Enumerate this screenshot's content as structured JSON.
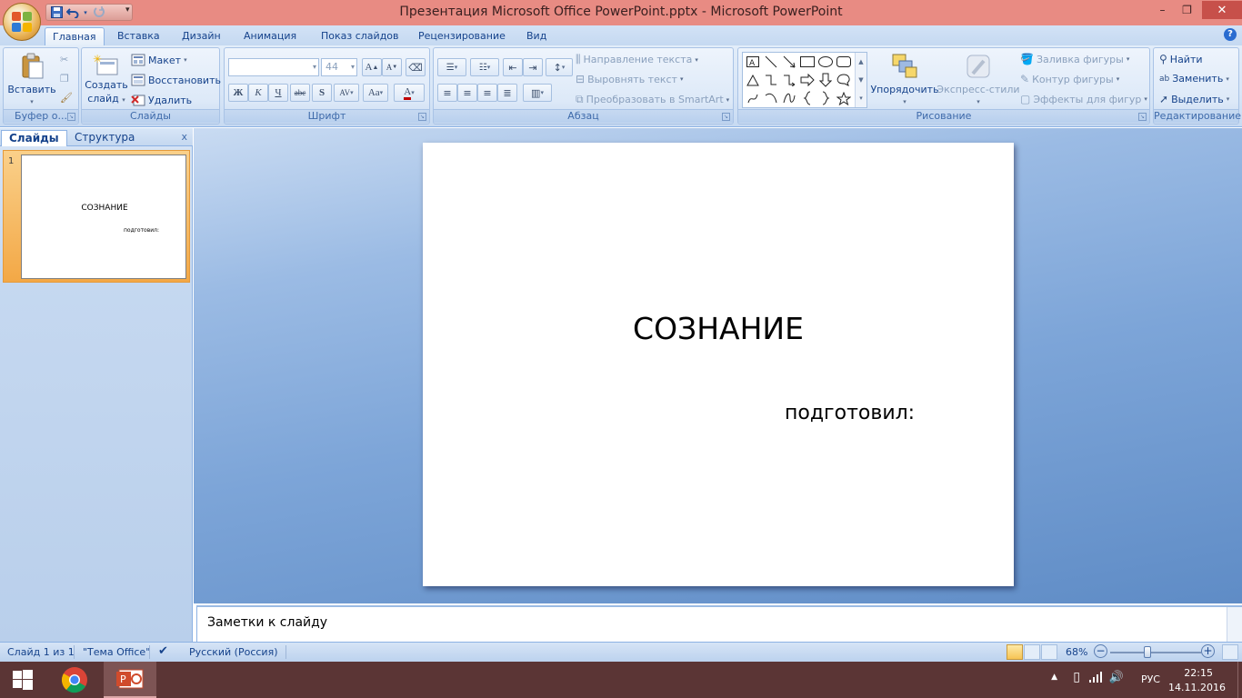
{
  "window": {
    "title": "Презентация Microsoft Office PowerPoint.pptx - Microsoft PowerPoint",
    "minimize": "–",
    "restore": "❐",
    "close": "✕"
  },
  "tabs": [
    "Главная",
    "Вставка",
    "Дизайн",
    "Анимация",
    "Показ слайдов",
    "Рецензирование",
    "Вид"
  ],
  "ribbon": {
    "clipboard": {
      "paste": "Вставить",
      "label": "Буфер о..."
    },
    "slides": {
      "new_slide_1": "Создать",
      "new_slide_2": "слайд",
      "layout": "Макет",
      "reset": "Восстановить",
      "delete": "Удалить",
      "label": "Слайды"
    },
    "font": {
      "font_name": "",
      "font_size": "44",
      "bold": "Ж",
      "italic": "К",
      "underline": "Ч",
      "strike": "abc",
      "shadow": "S",
      "spacing": "AV",
      "case": "Aa",
      "grow": "A",
      "shrink": "A",
      "label": "Шрифт"
    },
    "paragraph": {
      "text_direction": "Направление текста",
      "align_text": "Выровнять текст",
      "smartart": "Преобразовать в SmartArt",
      "label": "Абзац"
    },
    "drawing": {
      "arrange": "Упорядочить",
      "quick_styles": "Экспресс-стили",
      "fill": "Заливка фигуры",
      "outline": "Контур фигуры",
      "effects": "Эффекты для фигур",
      "label": "Рисование"
    },
    "editing": {
      "find": "Найти",
      "replace": "Заменить",
      "select": "Выделить",
      "label": "Редактирование"
    }
  },
  "panel": {
    "tab_slides": "Слайды",
    "tab_outline": "Структура",
    "close": "x",
    "slide_number": "1"
  },
  "slide": {
    "title": "СОЗНАНИЕ",
    "subtitle": "подготовил:"
  },
  "notes": {
    "placeholder": "Заметки к слайду"
  },
  "status": {
    "slide_info": "Слайд 1 из 1",
    "theme": "\"Тема Office\"",
    "language": "Русский (Россия)",
    "zoom": "68%",
    "zoom_level_fraction": 0.4
  },
  "taskbar": {
    "lang": "РУС",
    "time": "22:15",
    "date": "14.11.2016"
  },
  "colors": {
    "title_bar": "#e88b83",
    "taskbar": "#5b3535",
    "ribbon": "#dde9f8",
    "selected_thumb": "#f3a846"
  }
}
